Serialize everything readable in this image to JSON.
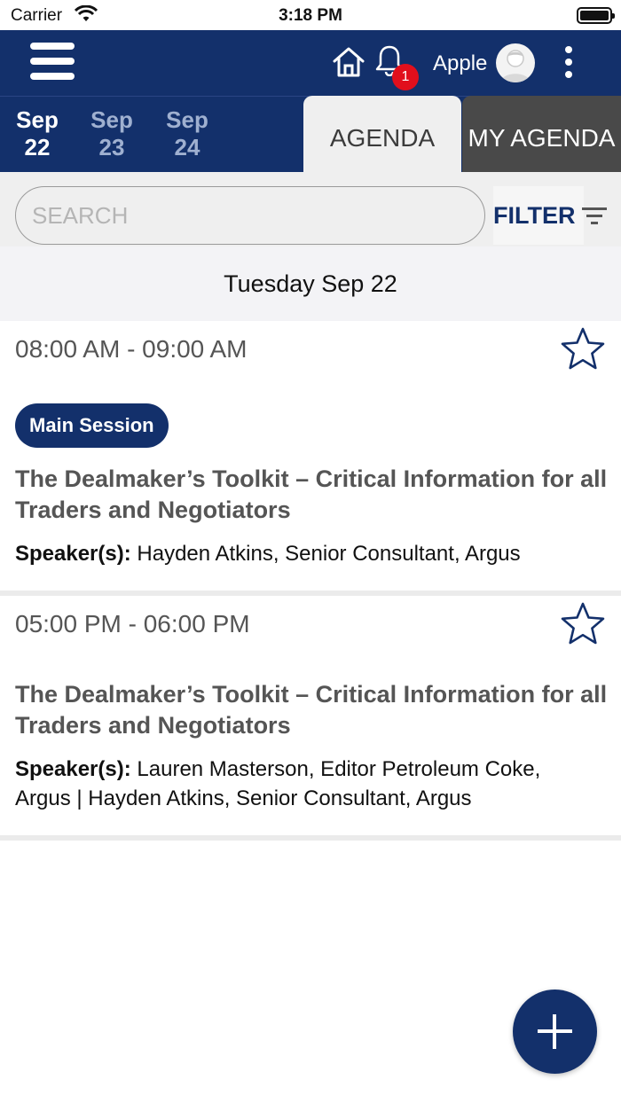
{
  "status_bar": {
    "carrier": "Carrier",
    "time": "3:18 PM"
  },
  "header": {
    "user_name": "Apple",
    "notification_count": "1"
  },
  "dates": [
    {
      "month": "Sep",
      "day": "22",
      "active": true
    },
    {
      "month": "Sep",
      "day": "23",
      "active": false
    },
    {
      "month": "Sep",
      "day": "24",
      "active": false
    }
  ],
  "tabs": {
    "agenda": "AGENDA",
    "my_agenda": "MY AGENDA"
  },
  "search": {
    "placeholder": "SEARCH",
    "value": ""
  },
  "filter": {
    "label": "FILTER"
  },
  "date_header": "Tuesday Sep 22",
  "sessions": [
    {
      "time": "08:00 AM - 09:00 AM",
      "track": "Main Session",
      "title": "The Dealmaker’s Toolkit – Critical Information for all Traders and Negotiators",
      "speakers_label": "Speaker(s):",
      "speakers": " Hayden Atkins, Senior Consultant, Argus"
    },
    {
      "time": "05:00 PM - 06:00 PM",
      "track": "",
      "title": "The Dealmaker’s Toolkit – Critical Information for all Traders and Negotiators",
      "speakers_label": "Speaker(s):",
      "speakers": " Lauren Masterson, Editor Petroleum Coke, Argus | Hayden Atkins, Senior Consultant, Argus"
    }
  ],
  "colors": {
    "primary": "#13306b",
    "inactive_tab": "#494949",
    "badge": "#e10f1c",
    "background_light": "#efefef"
  },
  "icons": [
    "menu-icon",
    "home-icon",
    "bell-icon",
    "avatar-icon",
    "more-vertical-icon",
    "filter-icon",
    "star-outline-icon",
    "plus-icon"
  ]
}
